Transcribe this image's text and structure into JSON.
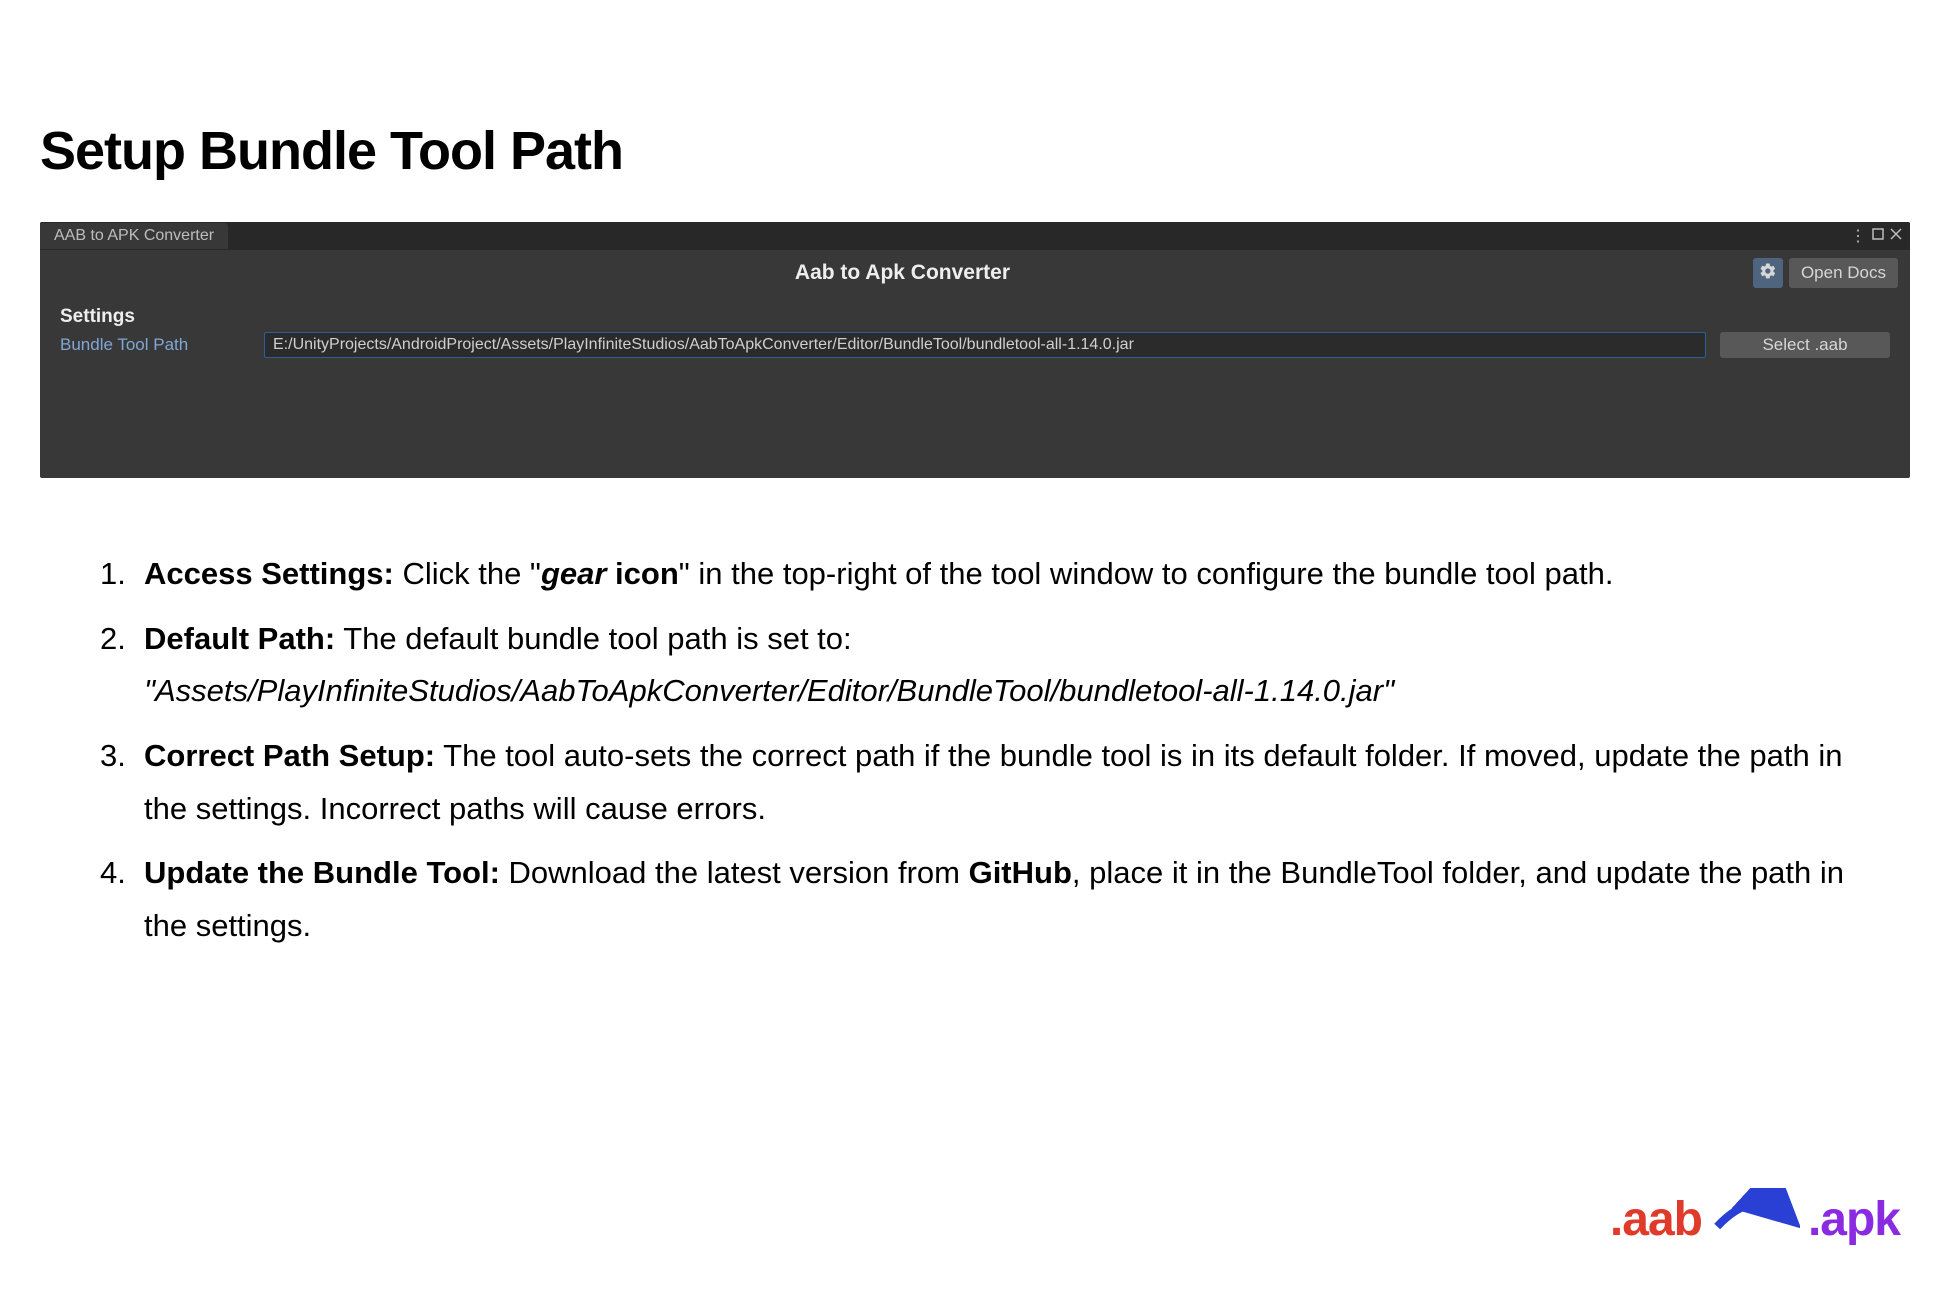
{
  "page": {
    "title": "Setup Bundle Tool Path"
  },
  "window": {
    "tab_label": "AAB to APK Converter",
    "title": "Aab to Apk Converter",
    "open_docs_label": "Open Docs",
    "settings_heading": "Settings",
    "field_label": "Bundle Tool Path",
    "path_value": "E:/UnityProjects/AndroidProject/Assets/PlayInfiniteStudios/AabToApkConverter/Editor/BundleTool/bundletool-all-1.14.0.jar",
    "select_aab_label": "Select .aab"
  },
  "instructions": {
    "item1": {
      "label": "Access Settings:",
      "pre": " Click the \"",
      "gear": "gear",
      "icon_word": " icon",
      "post": "\" in the top-right of the tool window to configure the bundle tool path."
    },
    "item2": {
      "label": "Default Path:",
      "text": " The default bundle tool path is set to:",
      "path": "\"Assets/PlayInfiniteStudios/AabToApkConverter/Editor/BundleTool/bundletool-all-1.14.0.jar\""
    },
    "item3": {
      "label": "Correct Path Setup:",
      "text": " The tool auto-sets the correct path if the bundle tool is in its default folder. If moved, update the path in the settings. Incorrect paths will cause errors."
    },
    "item4": {
      "label": "Update the Bundle Tool:",
      "pre": " Download the latest version from ",
      "github": "GitHub",
      "post": ", place it in the BundleTool folder, and update the path in the settings."
    }
  },
  "footer": {
    "aab": ".aab",
    "apk": ".apk"
  },
  "colors": {
    "accent_blue": "#4f657f",
    "link_blue": "#7fa7d4",
    "aab_red": "#e03a2a",
    "apk_purple": "#8a2be2",
    "arrow_blue": "#2a3fd4"
  }
}
